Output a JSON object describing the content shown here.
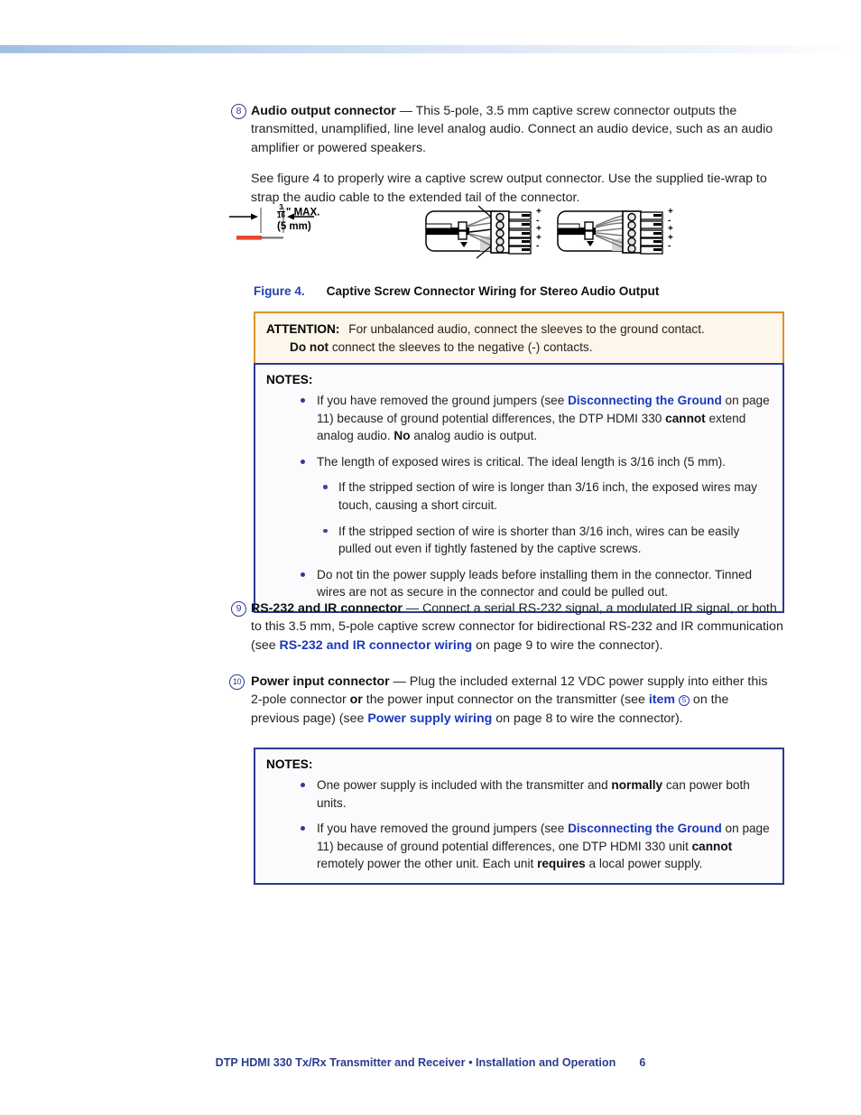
{
  "page": {
    "footer_text": "DTP HDMI 330 Tx/Rx Transmitter and Receiver • Installation and Operation",
    "page_number": "6",
    "accent_blue": "#2b3c8f",
    "link_blue": "#1b39bb",
    "attention_border": "#d9942a",
    "attention_bg": "#fdf6ea"
  },
  "items": [
    {
      "number": "8",
      "title": "Audio output connector",
      "dash": "—",
      "body_p1": " This 5-pole, 3.5 mm captive screw connector outputs the transmitted, unamplified, line level analog audio. Connect an audio device, such as an audio amplifier or powered speakers.",
      "body_p2": "See figure 4 to properly wire a captive screw output connector. Use the supplied tie-wrap to strap the audio cable to the extended tail of the connector."
    },
    {
      "number": "9",
      "title": "RS-232 and IR connector",
      "dash": "—",
      "body_pre": " Connect a serial RS-232 signal, a modulated IR signal, or both to this 3.5 mm, 5-pole captive screw connector for bidirectional RS-232 and IR communication (see ",
      "link": "RS-232 and IR connector wiring",
      "body_post": " on page 9 to wire the connector)."
    },
    {
      "number": "10",
      "title": "Power input connector",
      "dash": "—",
      "seg1": " Plug the included external 12 VDC power supply into either this 2-pole connector ",
      "bold1": "or",
      "seg2": " the power input connector on the transmitter (see ",
      "link1": "item",
      "circled": "5",
      "seg3": " on the previous page) (see ",
      "link2": "Power supply wiring",
      "seg4": " on page 8 to wire the connector)."
    }
  ],
  "figure": {
    "strip_label_numerator": "3",
    "strip_label_denominator": "16",
    "strip_label_unit": "\"",
    "strip_label_max": "MAX.",
    "strip_label_mm": "(5 mm)",
    "polarity_labels": [
      "+",
      "-",
      "+",
      "+",
      "-"
    ],
    "caption_number": "Figure 4.",
    "caption_text": "Captive Screw Connector Wiring for Stereo Audio Output"
  },
  "attention": {
    "label": "ATTENTION:",
    "line1": "For unbalanced audio, connect the sleeves to the ground contact.",
    "line2_bold": "Do not",
    "line2_rest": " connect the sleeves to the negative (-) contacts."
  },
  "notes_1": {
    "title": "NOTES:",
    "bullets": [
      {
        "pre": "If you have removed the ground jumpers (see ",
        "link": "Disconnecting the Ground",
        "mid": " on page 11) because of ground potential differences, the DTP HDMI 330 ",
        "bold1": "cannot",
        "mid2": " extend analog audio. ",
        "bold2": "No",
        "post": " analog audio is output."
      },
      {
        "text": "The length of exposed wires is critical. The ideal length is 3/16 inch (5 mm).",
        "sub": [
          "If the stripped section of wire is longer than 3/16 inch, the exposed wires may touch, causing a short circuit.",
          "If the stripped section of wire is shorter than 3/16 inch, wires can be easily pulled out even if tightly fastened by the captive screws."
        ]
      },
      {
        "text": "Do not tin the power supply leads before installing them in the connector. Tinned wires are not as secure in the connector and could be pulled out."
      }
    ]
  },
  "notes_2": {
    "title": "NOTES:",
    "bullets": [
      {
        "pre": "One power supply is included with the transmitter and ",
        "bold1": "normally",
        "post": " can power both units."
      },
      {
        "pre": "If you have removed the ground jumpers (see ",
        "link": "Disconnecting the Ground",
        "mid": " on page 11) because of ground potential differences, one DTP HDMI 330 unit ",
        "bold1": "cannot",
        "mid2": " remotely power the other unit. Each unit ",
        "bold2": "requires",
        "post": " a local power supply."
      }
    ]
  }
}
